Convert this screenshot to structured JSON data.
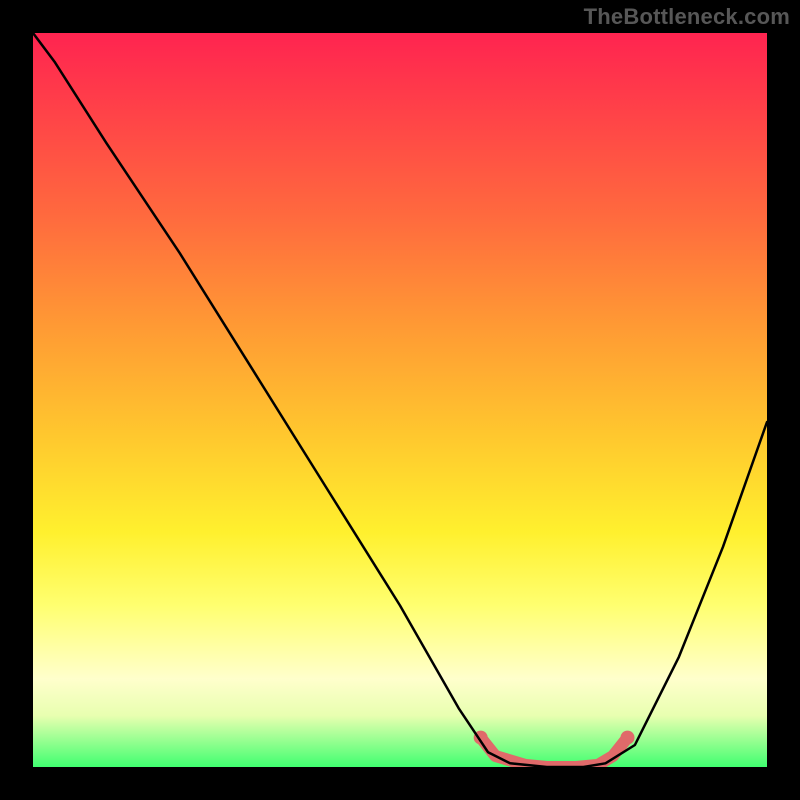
{
  "watermark": "TheBottleneck.com",
  "chart_data": {
    "type": "line",
    "title": "",
    "xlabel": "",
    "ylabel": "",
    "xlim": [
      0,
      100
    ],
    "ylim": [
      0,
      100
    ],
    "grid": false,
    "series": [
      {
        "name": "curve",
        "color": "#000000",
        "points": [
          {
            "x": 0,
            "y": 100
          },
          {
            "x": 3,
            "y": 96
          },
          {
            "x": 10,
            "y": 85
          },
          {
            "x": 20,
            "y": 70
          },
          {
            "x": 30,
            "y": 54
          },
          {
            "x": 40,
            "y": 38
          },
          {
            "x": 50,
            "y": 22
          },
          {
            "x": 58,
            "y": 8
          },
          {
            "x": 62,
            "y": 2
          },
          {
            "x": 65,
            "y": 0.5
          },
          {
            "x": 70,
            "y": 0
          },
          {
            "x": 75,
            "y": 0
          },
          {
            "x": 78,
            "y": 0.5
          },
          {
            "x": 82,
            "y": 3
          },
          {
            "x": 88,
            "y": 15
          },
          {
            "x": 94,
            "y": 30
          },
          {
            "x": 100,
            "y": 47
          }
        ]
      },
      {
        "name": "highlight-band",
        "color": "#e06a6a",
        "stroke_width": 12,
        "points": [
          {
            "x": 61,
            "y": 4
          },
          {
            "x": 63,
            "y": 1.5
          },
          {
            "x": 67,
            "y": 0.3
          },
          {
            "x": 70,
            "y": 0
          },
          {
            "x": 74,
            "y": 0
          },
          {
            "x": 77,
            "y": 0.3
          },
          {
            "x": 79,
            "y": 1.5
          },
          {
            "x": 81,
            "y": 4
          }
        ]
      }
    ]
  }
}
